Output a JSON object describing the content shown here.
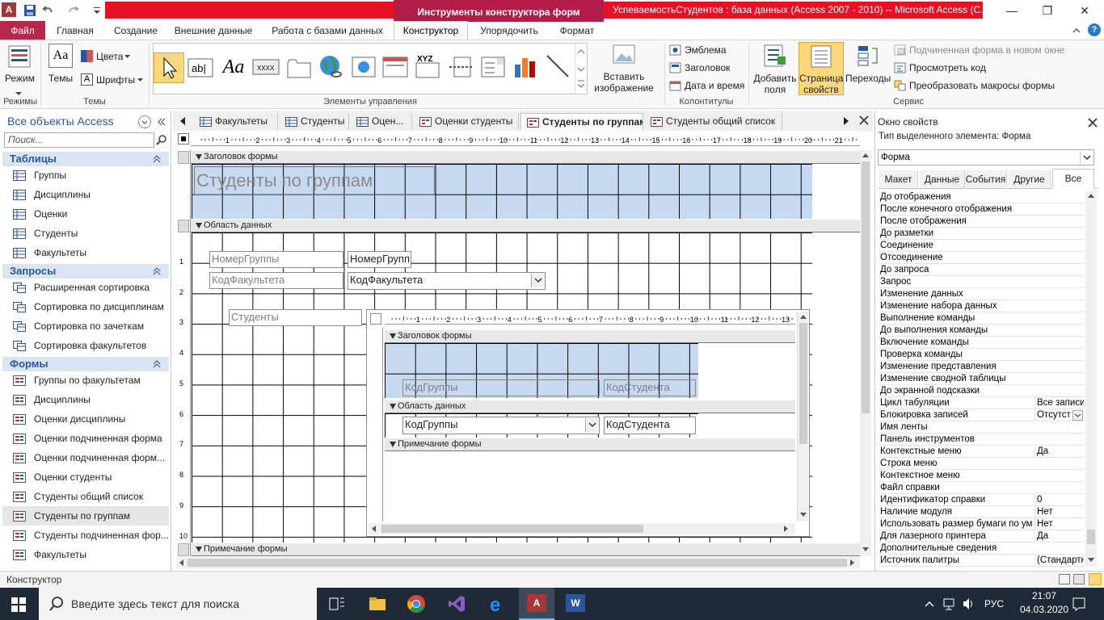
{
  "window": {
    "context_title": "Инструменты конструктора форм",
    "app_title": "УспеваемостьСтудентов : база данных (Access 2007 - 2010) -- Microsoft Access (С...",
    "minimize": "—",
    "maximize": "❐",
    "close": "✕"
  },
  "ribbon_tabs": [
    "Файл",
    "Главная",
    "Создание",
    "Внешние данные",
    "Работа с базами данных",
    "Конструктор",
    "Упорядочить",
    "Формат"
  ],
  "ribbon": {
    "view_label": "Режим",
    "themes_label": "Темы",
    "colors_label": "Цвета",
    "fonts_label": "Шрифты",
    "insert_image_label1": "Вставить",
    "insert_image_label2": "изображение",
    "emblem": "Эмблема",
    "title": "Заголовок",
    "datetime": "Дата и время",
    "add_fields1": "Добавить",
    "add_fields2": "поля",
    "prop_sheet1": "Страница",
    "prop_sheet2": "свойств",
    "transitions": "Переходы",
    "subform_new_window": "Подчиненная форма в новом окне",
    "view_code": "Просмотреть код",
    "convert_macros": "Преобразовать макросы формы",
    "groups": {
      "views": "Режимы",
      "themes": "Темы",
      "controls": "Элементы управления",
      "header_footer": "Колонтитулы",
      "tools": "Сервис"
    }
  },
  "nav": {
    "title": "Все объекты Access",
    "search_placeholder": "Поиск...",
    "sections": [
      {
        "name": "Таблицы",
        "items": [
          "Группы",
          "Дисциплины",
          "Оценки",
          "Студенты",
          "Факультеты"
        ]
      },
      {
        "name": "Запросы",
        "items": [
          "Расширенная сортировка",
          "Сортировка по дисциплинам",
          "Сортировка по зачеткам",
          "Сортировка факультетов"
        ]
      },
      {
        "name": "Формы",
        "items": [
          "Группы по факультетам",
          "Дисциплины",
          "Оценки дисциплины",
          "Оценки подчиненная форма",
          "Оценки подчиненная форм...",
          "Оценки студенты",
          "Студенты общий список",
          "Студенты по группам",
          "Студенты подчиненная фор...",
          "Факультеты"
        ]
      }
    ],
    "selected": "Студенты по группам"
  },
  "doc_tabs": [
    "Факультеты",
    "Студенты",
    "Оцен...",
    "Оценки студенты",
    "Студенты по группам",
    "Студенты общий список"
  ],
  "active_doc_tab": "Студенты по группам",
  "designer": {
    "section_form_header": "Заголовок формы",
    "section_detail": "Область данных",
    "section_form_footer": "Примечание формы",
    "form_title": "Студенты по группам",
    "lbl_group_no": "НомерГруппы",
    "txt_group_no": "НомерГрупп",
    "lbl_faculty": "КодФакультета",
    "txt_faculty": "КодФакультета",
    "lbl_students": "Студенты",
    "sub_section_header": "Заголовок формы",
    "sub_section_detail": "Область данных",
    "sub_section_footer": "Примечание формы",
    "sub_lbl_group": "КодГруппы",
    "sub_lbl_student": "КодСтудента",
    "sub_txt_group": "КодГруппы",
    "sub_txt_student": "КодСтудента",
    "ruler_numbers": [
      "1",
      "2",
      "3",
      "4",
      "5",
      "6",
      "7",
      "8",
      "9",
      "10",
      "11",
      "12",
      "13",
      "14",
      "15",
      "16",
      "17",
      "18",
      "19",
      "20",
      "21"
    ],
    "sub_ruler_numbers": [
      "1",
      "2",
      "3",
      "4",
      "5",
      "6",
      "7",
      "8",
      "9",
      "10",
      "11",
      "12",
      "13"
    ],
    "vruler_numbers": [
      "1",
      "2",
      "3",
      "4",
      "5",
      "6",
      "7",
      "8",
      "9",
      "10"
    ]
  },
  "props": {
    "title": "Окно свойств",
    "selection_type_label": "Тип выделенного элемента:  Форма",
    "selected_object": "Форма",
    "tabs": [
      "Макет",
      "Данные",
      "События",
      "Другие",
      "Все"
    ],
    "active_tab": "Все",
    "rows": [
      {
        "name": "До отображения",
        "value": ""
      },
      {
        "name": "После конечного отображения",
        "value": ""
      },
      {
        "name": "После отображения",
        "value": ""
      },
      {
        "name": "До разметки",
        "value": ""
      },
      {
        "name": "Соединение",
        "value": ""
      },
      {
        "name": "Отсоединение",
        "value": ""
      },
      {
        "name": "До запроса",
        "value": ""
      },
      {
        "name": "Запрос",
        "value": ""
      },
      {
        "name": "Изменение данных",
        "value": ""
      },
      {
        "name": "Изменение набора данных",
        "value": ""
      },
      {
        "name": "Выполнение команды",
        "value": ""
      },
      {
        "name": "До выполнения команды",
        "value": ""
      },
      {
        "name": "Включение команды",
        "value": ""
      },
      {
        "name": "Проверка команды",
        "value": ""
      },
      {
        "name": "Изменение представления",
        "value": ""
      },
      {
        "name": "Изменение сводной таблицы",
        "value": ""
      },
      {
        "name": "До экранной подсказки",
        "value": ""
      },
      {
        "name": "Цикл табуляции",
        "value": "Все записи"
      },
      {
        "name": "Блокировка записей",
        "value": "Отсутст"
      },
      {
        "name": "Имя ленты",
        "value": ""
      },
      {
        "name": "Панель инструментов",
        "value": ""
      },
      {
        "name": "Контекстные меню",
        "value": "Да"
      },
      {
        "name": "Строка меню",
        "value": ""
      },
      {
        "name": "Контекстное меню",
        "value": ""
      },
      {
        "name": "Файл справки",
        "value": ""
      },
      {
        "name": "Идентификатор справки",
        "value": "0"
      },
      {
        "name": "Наличие модуля",
        "value": "Нет"
      },
      {
        "name": "Использовать размер бумаги по ум",
        "value": "Нет"
      },
      {
        "name": "Для лазерного принтера",
        "value": "Да"
      },
      {
        "name": "Дополнительные сведения",
        "value": ""
      },
      {
        "name": "Источник палитры",
        "value": "(Стандартн"
      }
    ]
  },
  "status": {
    "text": "Конструктор"
  },
  "taskbar": {
    "search_placeholder": "Введите здесь текст для поиска",
    "lang": "РУС",
    "time": "21:07",
    "date": "04.03.2020"
  },
  "colors": {
    "accent": "#b7274a",
    "context_band": "#e81123",
    "section_blue": "#c6d9f1",
    "nav_section": "#dbe5f1"
  }
}
